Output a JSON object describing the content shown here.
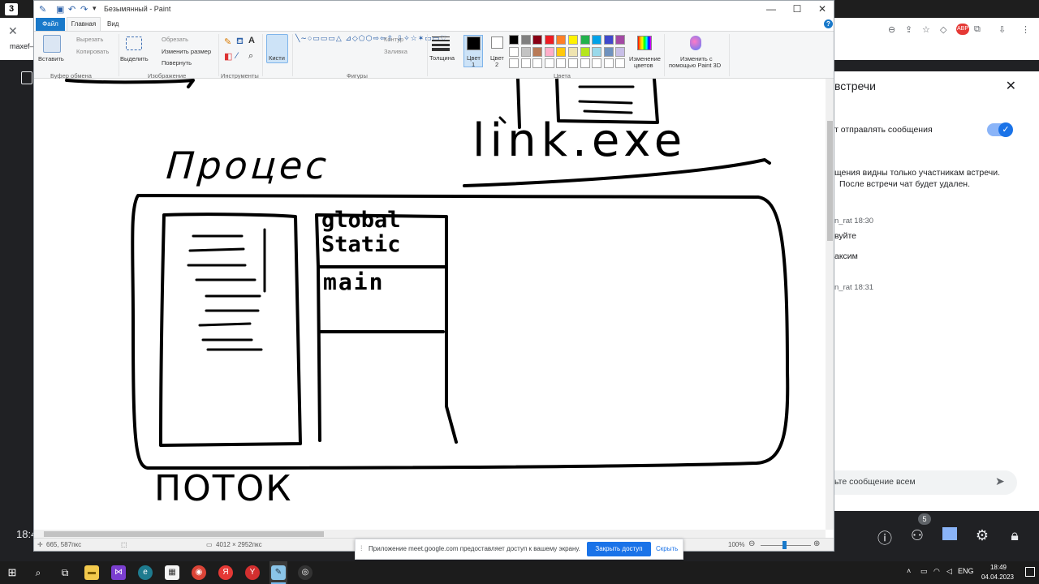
{
  "browser": {
    "tab_badge": "3",
    "left_text_1": "maxef–",
    "clock_fragment": "18:4"
  },
  "paint": {
    "window_title": "Безымянный - Paint",
    "tabs": {
      "file": "Файл",
      "home": "Главная",
      "view": "Вид"
    },
    "ribbon": {
      "clipboard": {
        "paste": "Вставить",
        "cut": "Вырезать",
        "copy": "Копировать",
        "group": "Буфер обмена"
      },
      "image": {
        "select": "Выделить",
        "crop": "Обрезать",
        "resize": "Изменить размер",
        "rotate": "Повернуть",
        "group": "Изображение"
      },
      "tools": {
        "group": "Инструменты"
      },
      "brushes": {
        "label": "Кисти"
      },
      "shapes": {
        "outline": "Контур",
        "fill": "Заливка",
        "group": "Фигуры"
      },
      "size": {
        "label": "Толщина"
      },
      "color1": {
        "label_line1": "Цвет",
        "label_line2": "1"
      },
      "color2": {
        "label_line1": "Цвет",
        "label_line2": "2"
      },
      "colors": {
        "group": "Цвета"
      },
      "edit_colors": {
        "line1": "Изменение",
        "line2": "цветов"
      },
      "paint3d": {
        "line1": "Изменить с",
        "line2": "помощью Paint 3D"
      }
    },
    "palette_colors": [
      "#000000",
      "#7f7f7f",
      "#880015",
      "#ed1c24",
      "#ff7f27",
      "#fff200",
      "#22b14c",
      "#00a2e8",
      "#3f48cc",
      "#a349a4",
      "#ffffff",
      "#c3c3c3",
      "#b97a57",
      "#ffaec9",
      "#ffc90e",
      "#efe4b0",
      "#b5e61d",
      "#99d9ea",
      "#7092be",
      "#c8bfe7",
      "#ffffff",
      "#ffffff",
      "#ffffff",
      "#ffffff",
      "#ffffff",
      "#ffffff",
      "#ffffff",
      "#ffffff",
      "#ffffff",
      "#ffffff"
    ],
    "status": {
      "cursor_pos": "665, 587пкс",
      "canvas_size": "4012 × 2952пкс",
      "zoom": "100%"
    },
    "drawing_labels": {
      "process": "Процес",
      "link_exe": "link.exe",
      "global_static": "global Static",
      "main": "main",
      "thread": "ПОТОК"
    }
  },
  "share_bar": {
    "message": "Приложение meet.google.com предоставляет доступ к вашему экрану.",
    "stop_button": "Закрыть доступ",
    "hide_link": "Скрыть"
  },
  "meet_panel": {
    "title": "встречи",
    "allow_messages": "т отправлять сообщения",
    "notice_line1": "щения видны только участникам встречи.",
    "notice_line2": "После встречи чат будет удален.",
    "msg1_author": "n_rat  18:30",
    "msg1_text": "вуйте",
    "msg2_text": "аксим",
    "msg3_author": "n_rat  18:31",
    "input_placeholder": "ьте сообщение всем",
    "participants_count": "5"
  },
  "taskbar": {
    "lang": "ENG",
    "time": "18:49",
    "date": "04.04.2023"
  }
}
